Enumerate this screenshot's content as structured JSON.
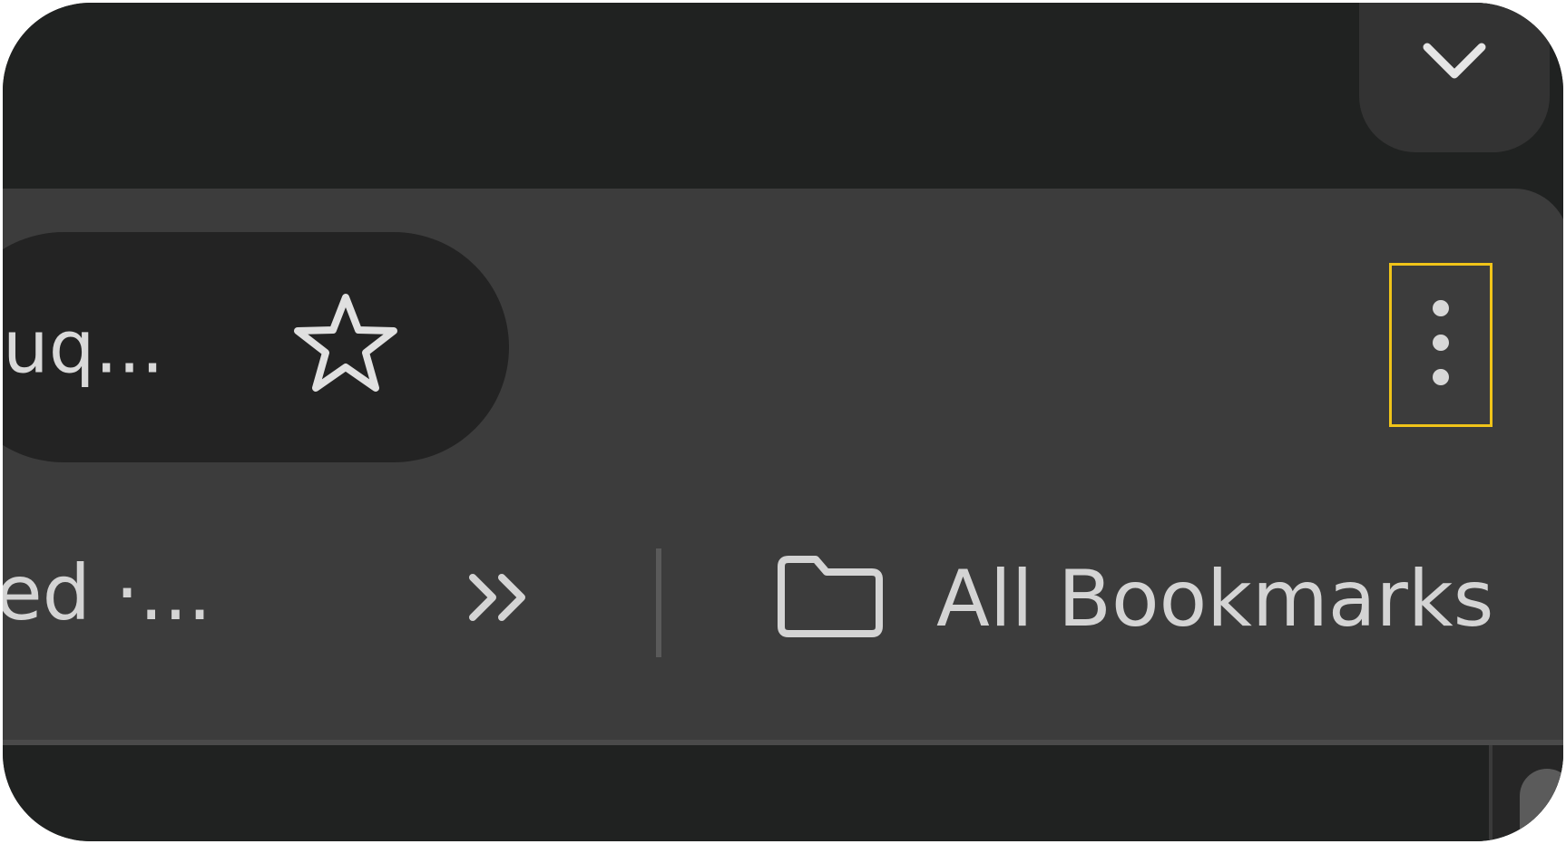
{
  "omnibox": {
    "url_fragment": "uq..."
  },
  "bookmarks_bar": {
    "truncated_item": "ed ·...",
    "all_bookmarks_label": "All Bookmarks"
  },
  "icons": {
    "tab_search": "chevron-down-icon",
    "bookmark_star": "star-icon",
    "menu": "more-vertical-icon",
    "overflow": "double-chevron-right-icon",
    "folder": "folder-icon"
  },
  "colors": {
    "highlight": "#f0c419",
    "toolbar": "#3c3c3c",
    "tabstrip": "#202221",
    "omnibox": "#232323"
  }
}
